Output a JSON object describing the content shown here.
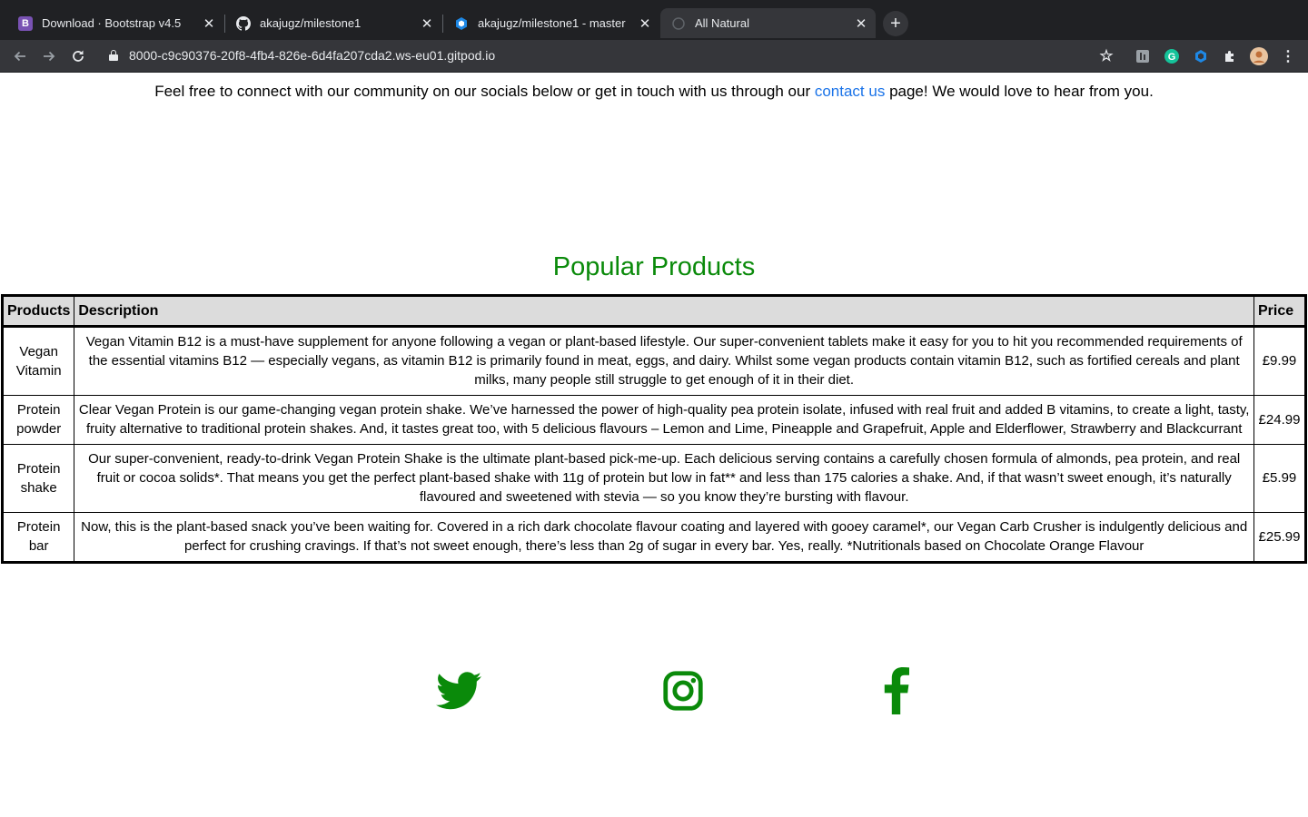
{
  "browser": {
    "tabs": [
      {
        "title": "Download · Bootstrap v4.5",
        "icon": "bootstrap-icon",
        "active": false
      },
      {
        "title": "akajugz/milestone1",
        "icon": "github-icon",
        "active": false
      },
      {
        "title": "akajugz/milestone1 - master",
        "icon": "gitpod-icon",
        "active": false
      },
      {
        "title": "All Natural",
        "icon": "globe-icon",
        "active": true
      }
    ],
    "url": "8000-c9c90376-20f8-4fb4-826e-6d4fa207cda2.ws-eu01.gitpod.io"
  },
  "intro": {
    "before": "Feel free to connect with our community on our socials below or get in touch with us through our ",
    "link": "contact us",
    "after": " page! We would love to hear from you."
  },
  "heading": "Popular Products",
  "table": {
    "headers": {
      "product": "Products",
      "description": "Description",
      "price": "Price"
    },
    "rows": [
      {
        "product": "Vegan Vitamin",
        "description": "Vegan Vitamin B12 is a must-have supplement for anyone following a vegan or plant-based lifestyle. Our super-convenient tablets make it easy for you to hit you recommended requirements of the essential vitamins B12 — especially vegans, as vitamin B12 is primarily found in meat, eggs, and dairy. Whilst some vegan products contain vitamin B12, such as fortified cereals and plant milks, many people still struggle to get enough of it in their diet.",
        "price": "£9.99"
      },
      {
        "product": "Protein powder",
        "description": "Clear Vegan Protein is our game-changing vegan protein shake. We’ve harnessed the power of high-quality pea protein isolate, infused with real fruit and added B vitamins, to create a light, tasty, fruity alternative to traditional protein shakes. And, it tastes great too, with 5 delicious flavours – Lemon and Lime, Pineapple and Grapefruit, Apple and Elderflower, Strawberry and Blackcurrant",
        "price": "£24.99"
      },
      {
        "product": "Protein shake",
        "description": "Our super-convenient, ready-to-drink Vegan Protein Shake is the ultimate plant-based pick-me-up. Each delicious serving contains a carefully chosen formula of almonds, pea protein, and real fruit or cocoa solids*. That means you get the perfect plant-based shake with 11g of protein but low in fat** and less than 175 calories a shake. And, if that wasn’t sweet enough, it’s naturally flavoured and sweetened with stevia — so you know they’re bursting with flavour.",
        "price": "£5.99"
      },
      {
        "product": "Protein bar",
        "description": "Now, this is the plant-based snack you’ve been waiting for. Covered in a rich dark chocolate flavour coating and layered with gooey caramel*, our Vegan Carb Crusher is indulgently delicious and perfect for crushing cravings. If that’s not sweet enough, there’s less than 2g of sugar in every bar. Yes, really. *Nutritionals based on Chocolate Orange Flavour",
        "price": "£25.99"
      }
    ]
  },
  "social": [
    "twitter-icon",
    "instagram-icon",
    "facebook-icon"
  ],
  "colors": {
    "brand_green": "#0a8a0a",
    "link_blue": "#1a73e8"
  }
}
